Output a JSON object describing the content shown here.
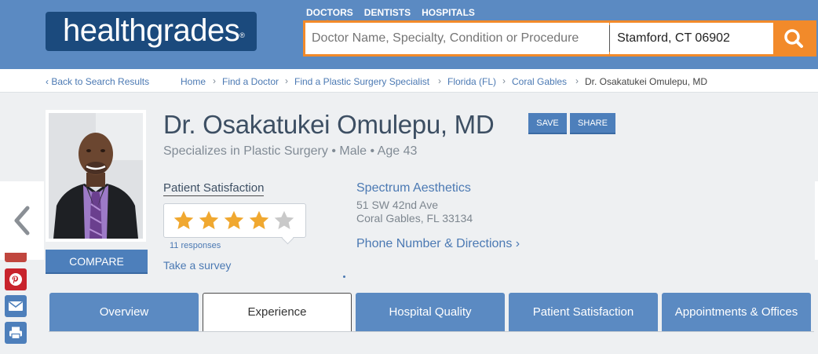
{
  "brand": {
    "logo_text": "healthgrades",
    "reg_mark": "®"
  },
  "topnav": {
    "items": [
      "DOCTORS",
      "DENTISTS",
      "HOSPITALS"
    ]
  },
  "search": {
    "query_placeholder": "Doctor Name, Specialty, Condition or Procedure",
    "location_value": "Stamford, CT 06902"
  },
  "breadcrumb": {
    "back": "Back to Search Results",
    "items": [
      "Home",
      "Find a Doctor",
      "Find a Plastic Surgery Specialist",
      "Florida (FL)",
      "Coral Gables"
    ],
    "current": "Dr. Osakatukei Omulepu, MD"
  },
  "profile": {
    "name": "Dr. Osakatukei Omulepu, MD",
    "subtitle": "Specializes in Plastic Surgery • Male • Age 43",
    "save_label": "SAVE",
    "share_label": "SHARE",
    "compare_label": "COMPARE"
  },
  "satisfaction": {
    "label": "Patient Satisfaction",
    "rating": 4,
    "max_rating": 5,
    "responses": "11 responses",
    "survey_link": "Take a survey"
  },
  "office": {
    "name": "Spectrum Aesthetics",
    "address_line1": "51 SW 42nd Ave",
    "address_line2": "Coral Gables, FL 33134",
    "phone_link": "Phone Number & Directions"
  },
  "tabs": [
    "Overview",
    "Experience",
    "Hospital Quality",
    "Patient Satisfaction",
    "Appointments & Offices"
  ],
  "active_tab": "Experience",
  "colors": {
    "header": "#5b8ac2",
    "logo_bg": "#1b4a7d",
    "accent": "#f28a2a",
    "link": "#4b79b3",
    "star": "#f0a830"
  },
  "icons": {
    "search": "magnifier-icon",
    "back": "chevron-left-icon",
    "social": [
      "pinterest-icon",
      "email-icon",
      "print-icon"
    ]
  }
}
